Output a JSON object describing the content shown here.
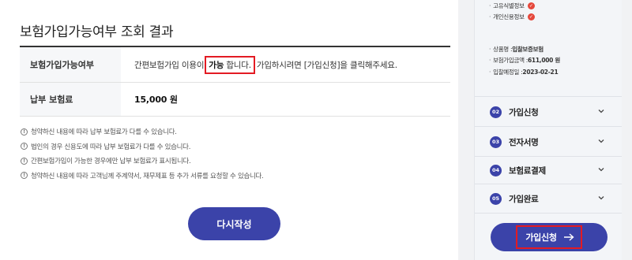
{
  "result": {
    "title": "보험가입가능여부 조회 결과",
    "rows": [
      {
        "label": "보험가입가능여부",
        "value_before": "간편보험가입 이용이",
        "value_highlight": "가능",
        "value_highlight_tail": "합니다.",
        "value_after": "가입하시려면 [가입신청]을 클릭해주세요."
      },
      {
        "label": "납부 보험료",
        "value": "15,000 원"
      }
    ],
    "notes": [
      "청약하신 내용에 따라 납부 보험료가 다를 수 있습니다.",
      "법인의 경우 신용도에 따라 납부 보험료가 다를 수 있습니다.",
      "간편보험가입이 가능한 경우에만 납부 보험료가 표시됩니다.",
      "청약하신 내용에 따라 고객님께 주계약서, 재무제표 등 추가 서류를 요청할 수 있습니다."
    ],
    "rewrite_button": "다시작성"
  },
  "sidebar": {
    "consents": [
      {
        "label": "고유식별정보"
      },
      {
        "label": "개인신용정보"
      }
    ],
    "summary": [
      {
        "label": "상품명 : ",
        "value": "입찰보증보험"
      },
      {
        "label": "보험가입금액 : ",
        "value": "611,000 원"
      },
      {
        "label": "입찰예정일 : ",
        "value": "2023-02-21"
      }
    ],
    "steps": [
      {
        "num": "02",
        "label": "가입신청"
      },
      {
        "num": "03",
        "label": "전자서명"
      },
      {
        "num": "04",
        "label": "보험료결제"
      },
      {
        "num": "05",
        "label": "가입완료"
      }
    ],
    "apply_button": "가입신청"
  },
  "colors": {
    "accent": "#3b43a9",
    "highlight_box": "#e31b23",
    "check": "#e5483c"
  },
  "icons": {
    "info": "info-circle-icon",
    "check": "check-circle-icon",
    "chevron": "chevron-down-icon",
    "arrow": "arrow-right-icon"
  }
}
